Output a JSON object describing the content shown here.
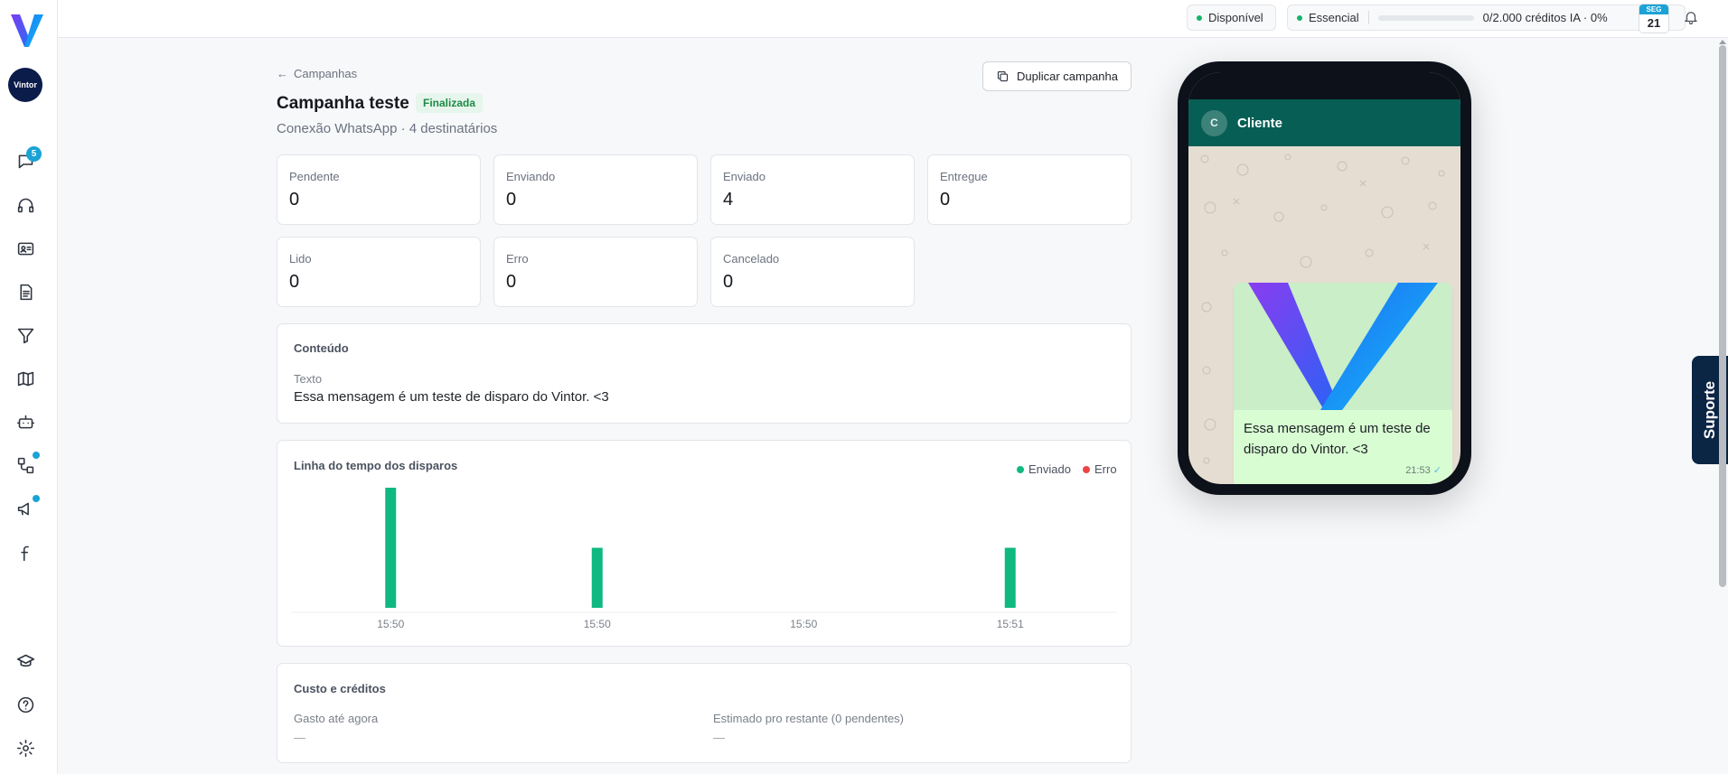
{
  "sidebar": {
    "avatar_text": "Vintor",
    "chat_badge": "5"
  },
  "topbar": {
    "availability": "Disponível",
    "plan": "Essencial",
    "credits_text": "0/2.000 créditos IA · 0%",
    "credits_progress": 0,
    "date_weekday": "SEG",
    "date_day": "21"
  },
  "header": {
    "back_label": "Campanhas",
    "title": "Campanha teste",
    "status": "Finalizada",
    "subtitle": "Conexão WhatsApp · 4 destinatários",
    "duplicate_label": "Duplicar campanha"
  },
  "stats": [
    {
      "label": "Pendente",
      "value": "0"
    },
    {
      "label": "Enviando",
      "value": "0"
    },
    {
      "label": "Enviado",
      "value": "4"
    },
    {
      "label": "Entregue",
      "value": "0"
    },
    {
      "label": "Lido",
      "value": "0"
    },
    {
      "label": "Erro",
      "value": "0"
    },
    {
      "label": "Cancelado",
      "value": "0"
    }
  ],
  "content": {
    "section_title": "Conteúdo",
    "field_label": "Texto",
    "text": "Essa mensagem é um teste de disparo do Vintor. <3"
  },
  "timeline": {
    "section_title": "Linha do tempo dos disparos",
    "legend": [
      {
        "label": "Enviado",
        "color": "#10b981"
      },
      {
        "label": "Erro",
        "color": "#ef4444"
      }
    ]
  },
  "chart_data": {
    "type": "bar",
    "categories": [
      "15:50",
      "15:50",
      "15:50",
      "15:51"
    ],
    "series": [
      {
        "name": "Enviado",
        "values": [
          2,
          1,
          0,
          1
        ]
      },
      {
        "name": "Erro",
        "values": [
          0,
          0,
          0,
          0
        ]
      }
    ],
    "ylim": [
      0,
      2
    ],
    "grid": false,
    "legend_position": "top-right"
  },
  "costs": {
    "section_title": "Custo e créditos",
    "spent_label": "Gasto até agora",
    "spent_value": "—",
    "estimated_label": "Estimado pro restante (0 pendentes)",
    "estimated_value": "—"
  },
  "preview": {
    "contact_initial": "C",
    "contact_name": "Cliente",
    "message": "Essa mensagem é um teste de disparo do Vintor. <3",
    "time": "21:53"
  },
  "support_label": "Suporte",
  "colors": {
    "accent": "#1aa3d6",
    "success": "#10b981",
    "error": "#ef4444",
    "whatsapp_header": "#075e54",
    "bubble": "#d9fdd3"
  }
}
